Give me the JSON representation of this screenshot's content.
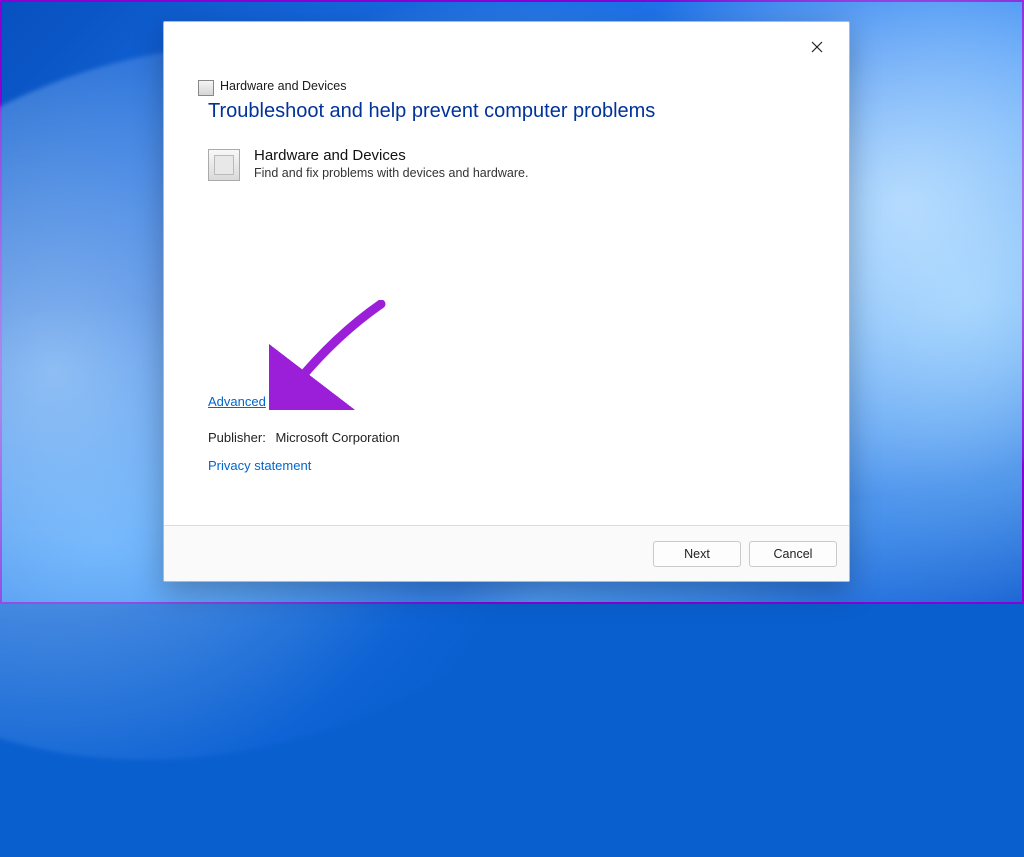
{
  "window": {
    "title": "Hardware and Devices"
  },
  "content": {
    "heading": "Troubleshoot and help prevent computer problems",
    "item_title": "Hardware and Devices",
    "item_desc": "Find and fix problems with devices and hardware.",
    "advanced_link": "Advanced",
    "publisher_label": "Publisher:",
    "publisher_value": "Microsoft Corporation",
    "privacy_link": "Privacy statement"
  },
  "buttons": {
    "next": "Next",
    "cancel": "Cancel"
  }
}
